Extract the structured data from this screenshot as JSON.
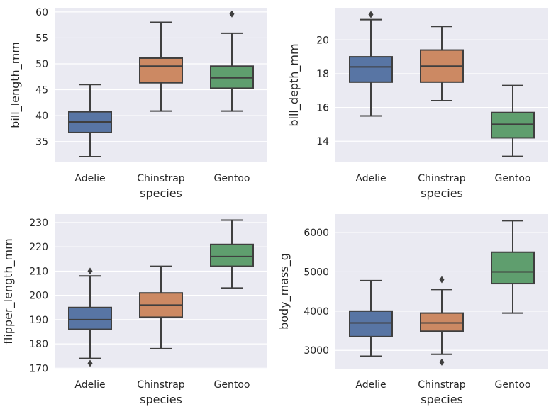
{
  "chart_data": [
    {
      "type": "box",
      "title": "",
      "xlabel": "species",
      "ylabel": "bill_length_mm",
      "categories": [
        "Adelie",
        "Chinstrap",
        "Gentoo"
      ],
      "colors": [
        "#5875A4",
        "#CC8963",
        "#5F9E6E"
      ],
      "ylim": [
        31.0,
        60.8
      ],
      "yticks": [
        35,
        40,
        45,
        50,
        55,
        60
      ],
      "grid": true,
      "boxes": [
        {
          "category": "Adelie",
          "whislo": 32.1,
          "q1": 36.75,
          "median": 38.8,
          "q3": 40.75,
          "whishi": 46.0,
          "fliers": []
        },
        {
          "category": "Chinstrap",
          "whislo": 40.9,
          "q1": 46.35,
          "median": 49.55,
          "q3": 51.1,
          "whishi": 58.0,
          "fliers": []
        },
        {
          "category": "Gentoo",
          "whislo": 40.9,
          "q1": 45.3,
          "median": 47.3,
          "q3": 49.55,
          "whishi": 55.9,
          "fliers": [
            59.6
          ]
        }
      ]
    },
    {
      "type": "box",
      "title": "",
      "xlabel": "species",
      "ylabel": "bill_depth_mm",
      "categories": [
        "Adelie",
        "Chinstrap",
        "Gentoo"
      ],
      "colors": [
        "#5875A4",
        "#CC8963",
        "#5F9E6E"
      ],
      "ylim": [
        12.75,
        21.9
      ],
      "yticks": [
        14,
        16,
        18,
        20
      ],
      "grid": true,
      "boxes": [
        {
          "category": "Adelie",
          "whislo": 15.5,
          "q1": 17.5,
          "median": 18.4,
          "q3": 19.0,
          "whishi": 21.2,
          "fliers": [
            21.5
          ]
        },
        {
          "category": "Chinstrap",
          "whislo": 16.4,
          "q1": 17.5,
          "median": 18.45,
          "q3": 19.4,
          "whishi": 20.8,
          "fliers": []
        },
        {
          "category": "Gentoo",
          "whislo": 13.1,
          "q1": 14.2,
          "median": 15.0,
          "q3": 15.7,
          "whishi": 17.3,
          "fliers": []
        }
      ]
    },
    {
      "type": "box",
      "title": "",
      "xlabel": "species",
      "ylabel": "flipper_length_mm",
      "categories": [
        "Adelie",
        "Chinstrap",
        "Gentoo"
      ],
      "colors": [
        "#5875A4",
        "#CC8963",
        "#5F9E6E"
      ],
      "ylim": [
        169.8,
        233.5
      ],
      "yticks": [
        170,
        180,
        190,
        200,
        210,
        220,
        230
      ],
      "grid": true,
      "boxes": [
        {
          "category": "Adelie",
          "whislo": 174,
          "q1": 186,
          "median": 190,
          "q3": 195,
          "whishi": 208,
          "fliers": [
            210,
            172
          ]
        },
        {
          "category": "Chinstrap",
          "whislo": 178,
          "q1": 191,
          "median": 196,
          "q3": 201,
          "whishi": 212,
          "fliers": []
        },
        {
          "category": "Gentoo",
          "whislo": 203,
          "q1": 212,
          "median": 216,
          "q3": 221,
          "whishi": 231,
          "fliers": []
        }
      ]
    },
    {
      "type": "box",
      "title": "",
      "xlabel": "species",
      "ylabel": "body_mass_g",
      "categories": [
        "Adelie",
        "Chinstrap",
        "Gentoo"
      ],
      "colors": [
        "#5875A4",
        "#CC8963",
        "#5F9E6E"
      ],
      "ylim": [
        2535,
        6470
      ],
      "yticks": [
        3000,
        4000,
        5000,
        6000
      ],
      "grid": true,
      "boxes": [
        {
          "category": "Adelie",
          "whislo": 2850,
          "q1": 3350,
          "median": 3700,
          "q3": 4000,
          "whishi": 4775,
          "fliers": []
        },
        {
          "category": "Chinstrap",
          "whislo": 2900,
          "q1": 3487,
          "median": 3700,
          "q3": 3950,
          "whishi": 4550,
          "fliers": [
            4800,
            2700
          ]
        },
        {
          "category": "Gentoo",
          "whislo": 3950,
          "q1": 4700,
          "median": 5000,
          "q3": 5500,
          "whishi": 6300,
          "fliers": []
        }
      ]
    }
  ]
}
